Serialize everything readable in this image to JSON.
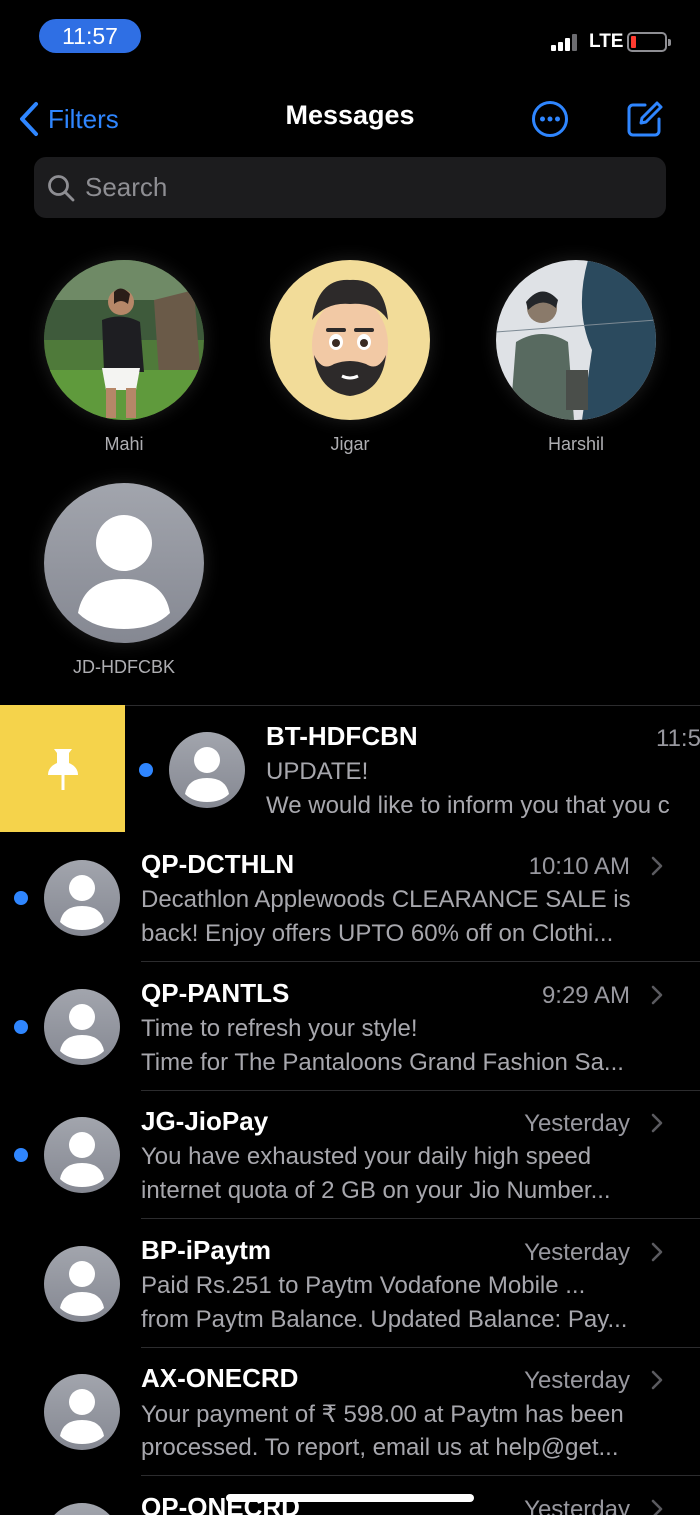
{
  "status_bar": {
    "time": "11:57",
    "network": "LTE",
    "battery_level": 0.1
  },
  "nav": {
    "back_label": "Filters",
    "title": "Messages",
    "more_icon": "ellipsis-circle-icon",
    "compose_icon": "compose-icon"
  },
  "search": {
    "placeholder": "Search"
  },
  "pinned": [
    {
      "name": "Mahi"
    },
    {
      "name": "Jigar"
    },
    {
      "name": "Harshil"
    },
    {
      "name": "JD-HDFCBK"
    }
  ],
  "swipe_action": {
    "icon": "pin-icon",
    "color": "#f5d34b"
  },
  "conversations": [
    {
      "sender": "BT-HDFCBN",
      "time": "11:5",
      "line1": "UPDATE!",
      "line2": "We would like to inform you that you c",
      "unread": true
    },
    {
      "sender": "QP-DCTHLN",
      "time": "10:10 AM",
      "line1": "Decathlon Applewoods CLEARANCE SALE is",
      "line2": "back! Enjoy offers UPTO 60% off on Clothi...",
      "unread": true
    },
    {
      "sender": "QP-PANTLS",
      "time": "9:29 AM",
      "line1": "Time to refresh your style!",
      "line2": "Time for The Pantaloons Grand Fashion Sa...",
      "unread": true
    },
    {
      "sender": "JG-JioPay",
      "time": "Yesterday",
      "line1": "You have exhausted your daily high speed",
      "line2": "internet quota of 2 GB on your Jio Number...",
      "unread": true
    },
    {
      "sender": "BP-iPaytm",
      "time": "Yesterday",
      "line1": "Paid Rs.251 to Paytm Vodafone Mobile ...",
      "line2": "from Paytm Balance. Updated Balance: Pay...",
      "unread": false
    },
    {
      "sender": "AX-ONECRD",
      "time": "Yesterday",
      "line1": "Your payment of ₹ 598.00 at Paytm has been",
      "line2": "processed. To report, email us at help@get...",
      "unread": false
    },
    {
      "sender": "QP-ONECRD",
      "time": "Yesterday",
      "line1": "",
      "line2": "",
      "unread": false
    }
  ],
  "colors": {
    "accent": "#2f86ff",
    "unread_dot": "#2f86ff",
    "time_pill": "#2f6fe4"
  }
}
